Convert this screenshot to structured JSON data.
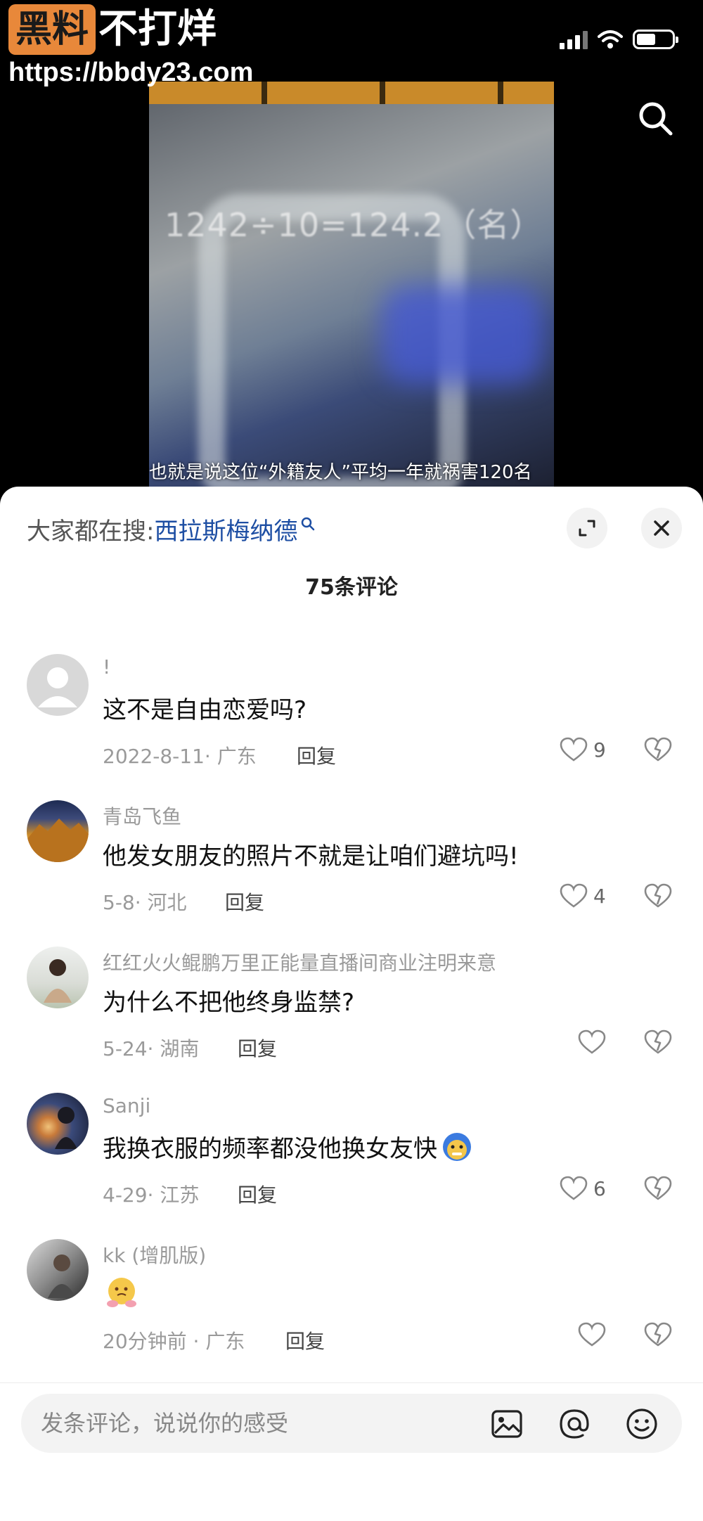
{
  "watermark": {
    "badge": "黑料",
    "rest": "不打烊",
    "url": "https://bbdy23.com"
  },
  "video": {
    "formula": "1242÷10=124.2（名）",
    "subtitle": "也就是说这位“外籍友人”平均一年就祸害120名"
  },
  "sheet": {
    "hot_search_label": "大家都在搜:",
    "hot_search_term": "西拉斯梅纳德",
    "comment_count": "75条评论"
  },
  "comments": [
    {
      "user": "!",
      "text": "这不是自由恋爱吗?",
      "meta": "2022-8-11· 广东",
      "reply": "回复",
      "likes": "9",
      "avatar_icon": "default-avatar"
    },
    {
      "user": "青岛飞鱼",
      "text": "他发女朋友的照片不就是让咱们避坑吗!",
      "meta": "5-8· 河北",
      "reply": "回复",
      "likes": "4",
      "avatar_icon": "mountain-avatar"
    },
    {
      "user": "红红火火鲲鹏万里正能量直播间商业注明来意",
      "text": "为什么不把他终身监禁?",
      "meta": "5-24· 湖南",
      "reply": "回复",
      "likes": "",
      "avatar_icon": "person-avatar"
    },
    {
      "user": "Sanji",
      "text": "我换衣服的频率都没他换女友快",
      "meta": "4-29· 江苏",
      "reply": "回复",
      "likes": "6",
      "avatar_icon": "sunset-avatar",
      "emoji_icon": "cold-face-emoji"
    },
    {
      "user": "kk (增肌版)",
      "text": "",
      "meta": "20分钟前 · 广东",
      "reply": "回复",
      "likes": "",
      "avatar_icon": "gym-avatar",
      "emoji_icon": "thinking-face-emoji"
    }
  ],
  "input": {
    "placeholder": "发条评论，说说你的感受"
  },
  "colors": {
    "accent_link": "#1d4ea3",
    "watermark_badge": "#e8883a"
  }
}
